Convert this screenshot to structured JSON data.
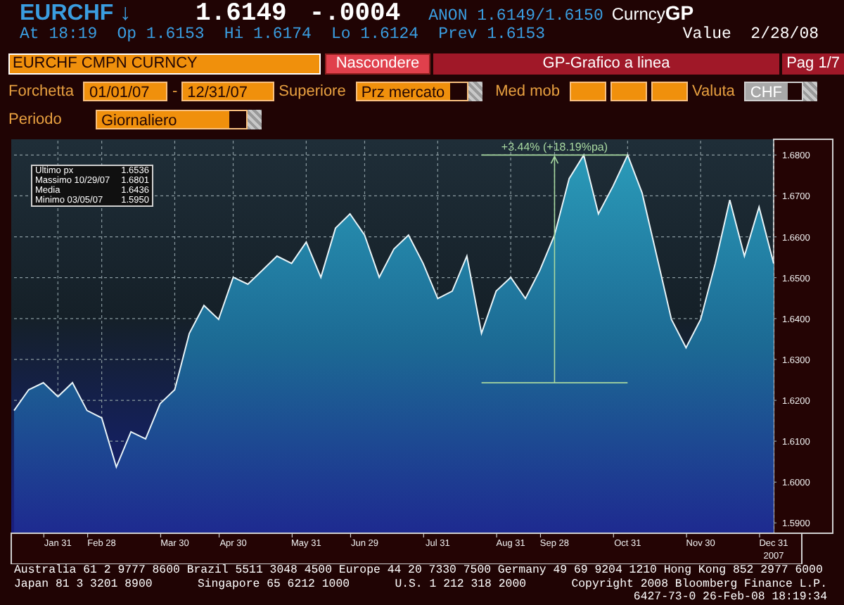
{
  "header": {
    "ticker": "EURCHF",
    "direction_arrow": "↓",
    "last": "1.6149",
    "change": "-.0004",
    "source": "ANON",
    "bid_ask": "1.6149/1.6150",
    "market": "Curncy",
    "function": "GP"
  },
  "quote": [
    {
      "label": "At",
      "value": "18:19"
    },
    {
      "label": "Op",
      "value": "1.6153"
    },
    {
      "label": "Hi",
      "value": "1.6174"
    },
    {
      "label": "Lo",
      "value": "1.6124"
    },
    {
      "label": "Prev",
      "value": "1.6153"
    }
  ],
  "value_date": {
    "label": "Value",
    "value": "2/28/08"
  },
  "command_bar": {
    "security": "EURCHF CMPN CURNCY",
    "hide_button": "Nascondere",
    "title": "GP-Grafico a linea",
    "page": "Pag 1/7"
  },
  "settings": {
    "range_label": "Forchetta",
    "start": "01/01/07",
    "separator": "-",
    "end": "12/31/07",
    "upper_label": "Superiore",
    "upper_value": "Prz mercato",
    "moving_avg_label": "Med mob",
    "currency_label": "Valuta",
    "currency": "CHF",
    "period_label": "Periodo",
    "period": "Giornaliero"
  },
  "chart": {
    "stats": [
      {
        "label": "Ultimo px",
        "value": "1.6536"
      },
      {
        "label": "Massimo 10/29/07",
        "value": "1.6801"
      },
      {
        "label": "Media",
        "value": "1.6436"
      },
      {
        "label": "Minimo 03/05/07",
        "value": "1.5950"
      }
    ],
    "year_label": "2007",
    "chart_data": {
      "type": "area",
      "categories": [
        null,
        null,
        null,
        "Jan 31",
        null,
        null,
        "Feb 28",
        null,
        null,
        null,
        null,
        "Mar 30",
        null,
        null,
        null,
        "Apr 30",
        null,
        null,
        null,
        null,
        "May 31",
        null,
        null,
        null,
        "Jun 29",
        null,
        null,
        null,
        null,
        "Jul 31",
        null,
        null,
        null,
        null,
        "Aug 31",
        null,
        null,
        "Sep 28",
        null,
        null,
        null,
        null,
        "Oct 31",
        null,
        null,
        null,
        null,
        "Nov 30",
        null,
        null,
        null,
        null,
        "Dec 31"
      ],
      "series": [
        {
          "color": "#2a9ab8",
          "values": [
            1.6175,
            1.6226,
            1.6243,
            1.6209,
            1.6243,
            1.6175,
            1.6157,
            1.6037,
            1.6123,
            1.6106,
            1.6192,
            1.6226,
            1.6364,
            1.6432,
            1.6398,
            1.6501,
            1.6484,
            1.6518,
            1.6553,
            1.6535,
            1.6587,
            1.6501,
            1.6621,
            1.6656,
            1.6604,
            1.6501,
            1.657,
            1.6604,
            1.6535,
            1.6449,
            1.6467,
            1.6553,
            1.6364,
            1.6467,
            1.6501,
            1.6449,
            1.6518,
            1.6604,
            1.6742,
            1.68,
            1.6656,
            1.6724,
            1.68,
            1.6707,
            1.6553,
            1.6398,
            1.6329,
            1.6398,
            1.6535,
            1.669,
            1.6553,
            1.6673,
            1.6535
          ]
        }
      ],
      "ylim": [
        1.5875,
        1.6835
      ],
      "grid": true,
      "yticks": [
        {
          "value": 1.59,
          "label": "1.5900"
        },
        {
          "value": 1.6,
          "label": "1.6000"
        },
        {
          "value": 1.61,
          "label": "1.6100"
        },
        {
          "value": 1.62,
          "label": "1.6200"
        },
        {
          "value": 1.63,
          "label": "1.6300"
        },
        {
          "value": 1.64,
          "label": "1.6400"
        },
        {
          "value": 1.65,
          "label": "1.6500"
        },
        {
          "value": 1.66,
          "label": "1.6600"
        },
        {
          "value": 1.67,
          "label": "1.6700"
        },
        {
          "value": 1.68,
          "label": "1.6800"
        }
      ],
      "annotations": [
        "+3.44% (+18.19%pa)"
      ]
    }
  },
  "footer": [
    [
      "Australia 61 2 9777 8600 Brazil 5511 3048 4500 Europe 44 20 7330 7500 Germany 49 69 9204 1210 Hong Kong 852 2977 6000"
    ],
    [
      "Japan 81 3 3201 8900",
      "Singapore 65 6212 1000",
      "U.S. 1 212 318 2000",
      "Copyright 2008 Bloomberg Finance L.P."
    ],
    [
      "6427-73-0 26-Feb-08 18:19:34"
    ]
  ]
}
